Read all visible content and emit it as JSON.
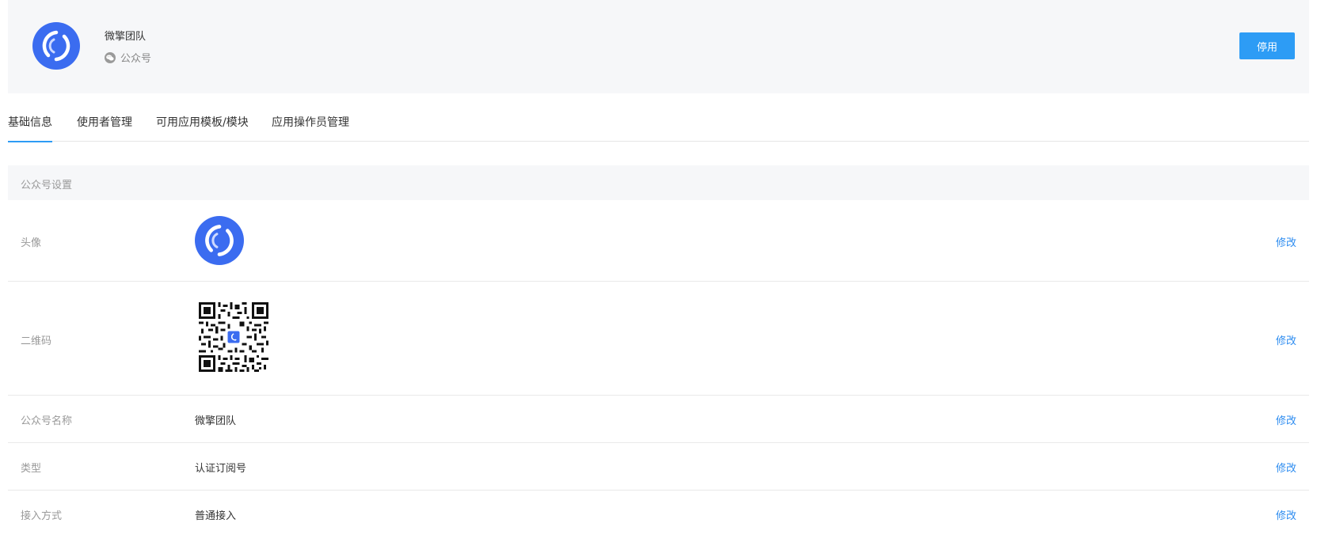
{
  "header": {
    "name": "微擎团队",
    "type": "公众号",
    "stop_label": "停用"
  },
  "tabs": [
    {
      "label": "基础信息",
      "active": true
    },
    {
      "label": "使用者管理"
    },
    {
      "label": "可用应用模板/模块"
    },
    {
      "label": "应用操作员管理"
    }
  ],
  "section": {
    "title": "公众号设置"
  },
  "rows": [
    {
      "label": "头像",
      "value": "",
      "edit": "修改"
    },
    {
      "label": "二维码",
      "value": "",
      "edit": "修改"
    },
    {
      "label": "公众号名称",
      "value": "微擎团队",
      "edit": "修改"
    },
    {
      "label": "类型",
      "value": "认证订阅号",
      "edit": "修改"
    },
    {
      "label": "接入方式",
      "value": "普通接入",
      "edit": "修改"
    }
  ],
  "colors": {
    "accent": "#2d9cf5",
    "link": "#2d8cf0",
    "logo_blue": "#3b6cf0",
    "header_bg": "#f6f7f9"
  },
  "icons": {
    "logo": "weiqing-logo-icon",
    "wechat": "wechat-icon",
    "qrcode": "qrcode-image"
  }
}
